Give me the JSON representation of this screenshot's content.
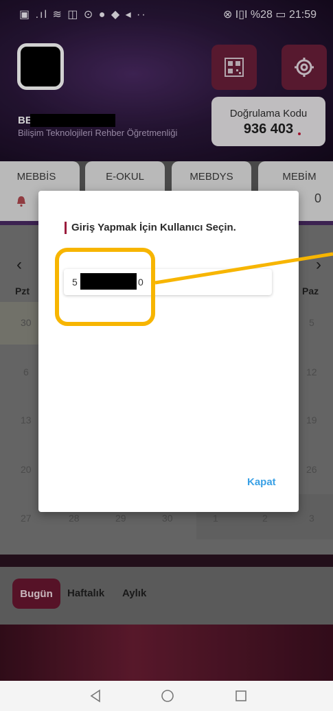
{
  "status_bar": {
    "left_icons": "▣ .ıl ≋ ◫ ⊙ ● ◆ ◂ ··",
    "right_text": "⊗ I▯I %28 ▭ 21:59"
  },
  "profile": {
    "name": "BEI",
    "role": "Bilişim Teknolojileri Rehber Öğretmenliği"
  },
  "verification": {
    "title": "Doğrulama Kodu",
    "code": "936 403"
  },
  "tabs": [
    {
      "label": "MEBBİS"
    },
    {
      "label": "E-OKUL"
    },
    {
      "label": "MEBDYS"
    },
    {
      "label": "MEBİM"
    }
  ],
  "tab_counter": "0",
  "calendar": {
    "prev": "‹",
    "next": "›",
    "headers": [
      "Pzt",
      "Paz"
    ],
    "rows": [
      {
        "left": "30",
        "right": "5"
      },
      {
        "left": "6",
        "right": "12"
      },
      {
        "left": "13",
        "right": "19"
      },
      {
        "left": "20",
        "right": "26"
      }
    ],
    "bottom_row": [
      "27",
      "28",
      "29",
      "30",
      "1",
      "2",
      "3"
    ]
  },
  "range_selector": {
    "today": "Bugün",
    "weekly": "Haftalık",
    "monthly": "Aylık"
  },
  "dialog": {
    "title": "Giriş Yapmak İçin Kullanıcı Seçin.",
    "user_prefix": "5",
    "user_suffix": "0",
    "close": "Kapat"
  },
  "icons": {
    "qr": "qr-code-icon",
    "settings": "gear-icon",
    "notification": "bell-icon",
    "nav_back": "back-triangle-icon",
    "nav_home": "home-circle-icon",
    "nav_recent": "recent-square-icon"
  },
  "colors": {
    "accent": "#9b1c3d",
    "link": "#39a0e5",
    "highlight": "#f7b500"
  }
}
